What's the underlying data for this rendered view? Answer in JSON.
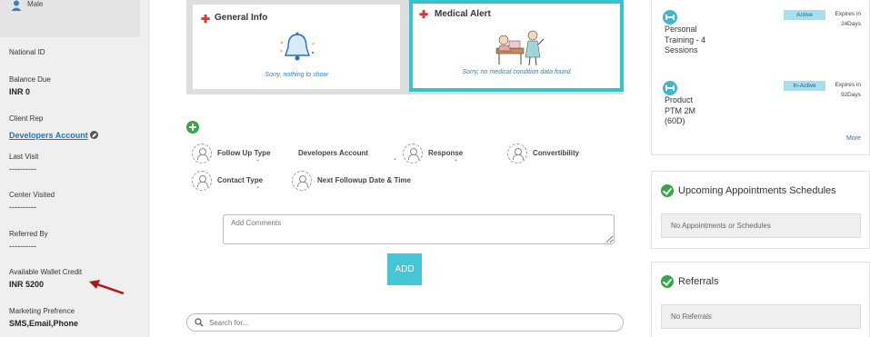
{
  "sidebar": {
    "gender": "Male",
    "fields": {
      "national_id": {
        "label": "National ID"
      },
      "balance_due": {
        "label": "Balance Due",
        "value": "INR 0"
      },
      "client_rep": {
        "label": "Client Rep",
        "value": "Developers Account"
      },
      "last_visit": {
        "label": "Last Visit",
        "value": "----------"
      },
      "center_visited": {
        "label": "Center Visited",
        "value": "----------"
      },
      "referred_by": {
        "label": "Referred By",
        "value": "----------"
      },
      "wallet_credit": {
        "label": "Available Wallet Credit",
        "value": "INR 5200"
      },
      "marketing": {
        "label": "Marketing Prefrence",
        "value": "SMS,Email,Phone"
      }
    }
  },
  "cards": {
    "general": {
      "title": "General Info",
      "empty_text": "Sorry, nothing to show"
    },
    "medical": {
      "title": "Medical Alert",
      "empty_text": "Sorry, no medical condition data found"
    }
  },
  "followup": {
    "follow_up_type": "Follow Up Type",
    "assigned_to": "Developers Account",
    "response": "Response",
    "convertibility": "Convertibility",
    "contact_type": "Contact Type",
    "next_followup": "Next Followup Date & Time",
    "comment_placeholder": "Add Comments",
    "add_label": "ADD",
    "search_placeholder": "Search for..."
  },
  "memberships": {
    "items": [
      {
        "name": "Personal Training - 4 Sessions",
        "status": "Active",
        "expires_line1": "Expires in",
        "expires_line2": "24Days"
      },
      {
        "name": "Product PTM 2M (60D)",
        "status": "In-Active",
        "expires_line1": "Expires in",
        "expires_line2": "92Days"
      }
    ],
    "more_label": "More"
  },
  "appointments": {
    "title": "Upcoming Appointments Schedules",
    "empty_text": "No Appointments or Schedules"
  },
  "referrals": {
    "title": "Referrals",
    "empty_text": "No Referrals"
  },
  "colors": {
    "accent_teal": "#36c3cf",
    "add_green": "#35a845",
    "link_blue": "#1a73c8",
    "alert_red": "#e0332d",
    "arrow_red": "#b01818"
  }
}
